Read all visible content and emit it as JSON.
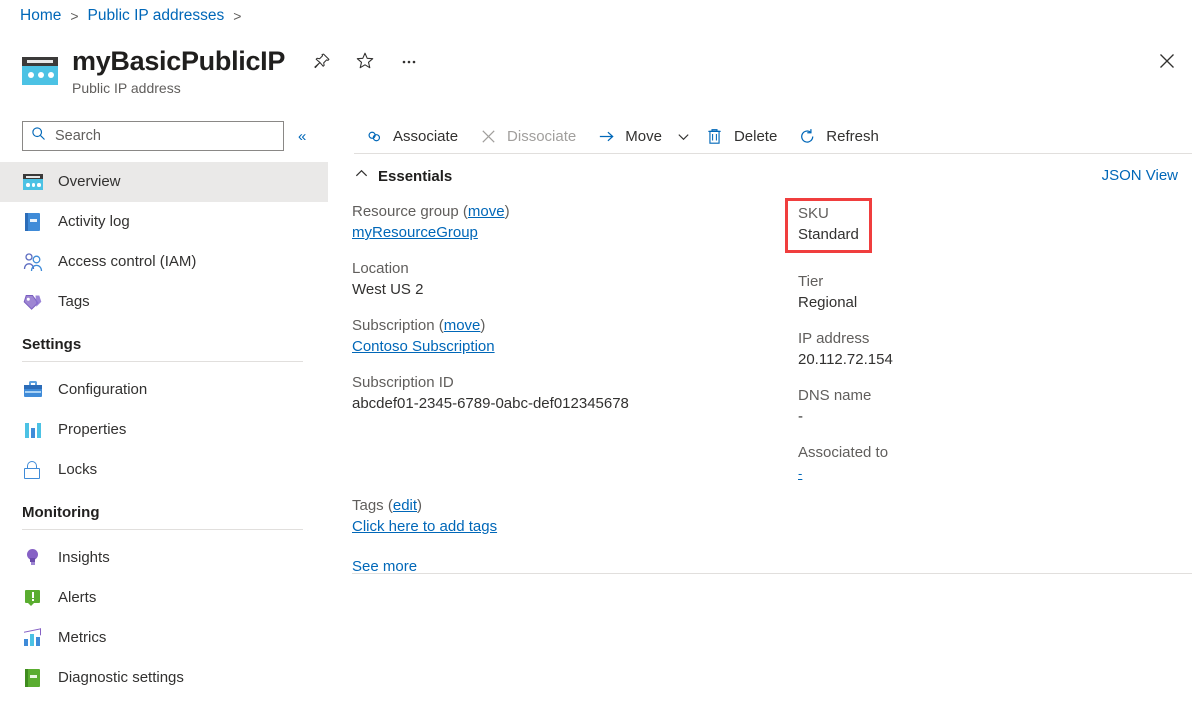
{
  "breadcrumb": {
    "items": [
      {
        "label": "Home"
      },
      {
        "label": "Public IP addresses"
      }
    ],
    "separator": ">"
  },
  "header": {
    "title": "myBasicPublicIP",
    "subtitle": "Public IP address",
    "resource_icon": "public-ip-icon",
    "actions": [
      {
        "name": "pin-icon",
        "label": "Pin"
      },
      {
        "name": "favorite-star-icon",
        "label": "Favorite"
      },
      {
        "name": "more-ellipsis-icon",
        "label": "More"
      }
    ],
    "close_label": "Close"
  },
  "sidebar": {
    "search": {
      "placeholder": "Search",
      "value": "",
      "icon": "search-icon"
    },
    "collapse": {
      "icon": "chevron-double-left-icon",
      "label": "«"
    },
    "items": [
      {
        "label": "Overview",
        "icon": "overview-icon",
        "selected": true
      },
      {
        "label": "Activity log",
        "icon": "activity-log-icon",
        "selected": false
      },
      {
        "label": "Access control (IAM)",
        "icon": "access-control-icon",
        "selected": false
      },
      {
        "label": "Tags",
        "icon": "tags-icon",
        "selected": false
      }
    ],
    "sections": [
      {
        "title": "Settings",
        "items": [
          {
            "label": "Configuration",
            "icon": "configuration-icon"
          },
          {
            "label": "Properties",
            "icon": "properties-icon"
          },
          {
            "label": "Locks",
            "icon": "locks-icon"
          }
        ]
      },
      {
        "title": "Monitoring",
        "items": [
          {
            "label": "Insights",
            "icon": "insights-icon"
          },
          {
            "label": "Alerts",
            "icon": "alerts-icon"
          },
          {
            "label": "Metrics",
            "icon": "metrics-icon"
          },
          {
            "label": "Diagnostic settings",
            "icon": "diagnostic-settings-icon"
          }
        ]
      }
    ]
  },
  "toolbar": {
    "associate": {
      "label": "Associate",
      "icon": "link-icon",
      "enabled": true
    },
    "dissociate": {
      "label": "Dissociate",
      "icon": "close-x-icon",
      "enabled": false
    },
    "move": {
      "label": "Move",
      "icon": "arrow-right-icon",
      "caret": "chevron-down-icon",
      "enabled": true
    },
    "delete": {
      "label": "Delete",
      "icon": "trash-icon",
      "enabled": true
    },
    "refresh": {
      "label": "Refresh",
      "icon": "refresh-icon",
      "enabled": true
    }
  },
  "essentials": {
    "header": "Essentials",
    "collapse_icon": "chevron-up-icon",
    "json_view": "JSON View",
    "left_fields": [
      {
        "label": "Resource group",
        "label_suffix_link": "move",
        "value": "myResourceGroup",
        "value_is_link": true
      },
      {
        "label": "Location",
        "value": "West US 2",
        "value_is_link": false
      },
      {
        "label": "Subscription",
        "label_suffix_link": "move",
        "value": "Contoso Subscription",
        "value_is_link": true
      },
      {
        "label": "Subscription ID",
        "value": "abcdef01-2345-6789-0abc-def012345678",
        "value_is_link": false
      }
    ],
    "right_fields": [
      {
        "label": "SKU",
        "value": "Standard",
        "value_is_link": false,
        "highlighted": true
      },
      {
        "label": "Tier",
        "value": "Regional",
        "value_is_link": false,
        "highlighted": false
      },
      {
        "label": "IP address",
        "value": "20.112.72.154",
        "value_is_link": false,
        "highlighted": false
      },
      {
        "label": "DNS name",
        "value": "-",
        "value_is_link": false,
        "highlighted": false
      },
      {
        "label": "Associated to",
        "value": "-",
        "value_is_link": true,
        "highlighted": false
      }
    ],
    "tags": {
      "label": "Tags",
      "edit_link": "edit",
      "add_link": "Click here to add tags"
    },
    "see_more": "See more"
  },
  "colors": {
    "link": "#0067b8",
    "highlight_border": "#f03e3e",
    "selected_nav_bg": "#eae9e8",
    "text": "#323130",
    "muted_text": "#605e5c"
  }
}
